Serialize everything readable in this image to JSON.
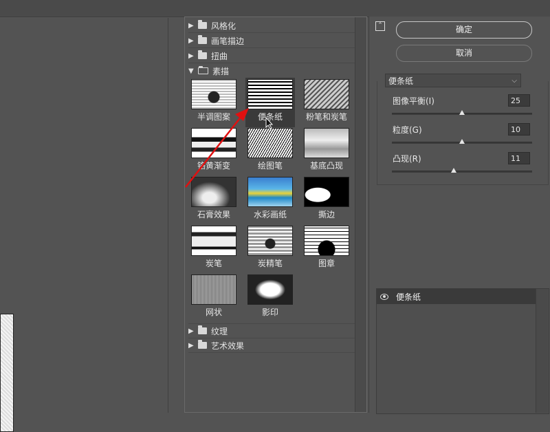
{
  "gallery": {
    "categories_top": [
      {
        "label": "风格化",
        "expanded": false
      },
      {
        "label": "画笔描边",
        "expanded": false
      },
      {
        "label": "扭曲",
        "expanded": false
      },
      {
        "label": "素描",
        "expanded": true
      }
    ],
    "categories_bottom": [
      {
        "label": "纹理",
        "expanded": false
      },
      {
        "label": "艺术效果",
        "expanded": false
      }
    ],
    "filters": [
      {
        "label": "半调图案"
      },
      {
        "label": "便条纸",
        "selected": true
      },
      {
        "label": "粉笔和炭笔"
      },
      {
        "label": "铬黄渐变"
      },
      {
        "label": "绘图笔"
      },
      {
        "label": "基底凸现"
      },
      {
        "label": "石膏效果"
      },
      {
        "label": "水彩画纸"
      },
      {
        "label": "撕边"
      },
      {
        "label": "炭笔"
      },
      {
        "label": "炭精笔"
      },
      {
        "label": "图章"
      },
      {
        "label": "网状"
      },
      {
        "label": "影印"
      }
    ]
  },
  "dialog": {
    "ok_label": "确定",
    "cancel_label": "取消",
    "collapse_icon": "chevron-up-icon"
  },
  "settings": {
    "filter_select": "便条纸",
    "params": [
      {
        "label": "图像平衡(I)",
        "value": "25",
        "slider_fraction": 0.5
      },
      {
        "label": "粒度(G)",
        "value": "10",
        "slider_fraction": 0.5
      },
      {
        "label": "凸现(R)",
        "value": "11",
        "slider_fraction": 0.44
      }
    ]
  },
  "layers": {
    "items": [
      {
        "name": "便条纸",
        "visible": true
      }
    ]
  },
  "annotation": {
    "color": "#e01010"
  }
}
